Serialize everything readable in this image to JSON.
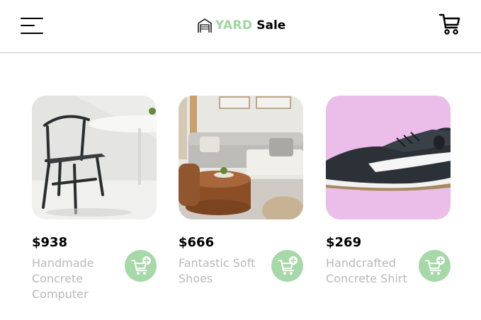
{
  "header": {
    "logo": {
      "brand_part1": "YARD",
      "brand_part2": "Sale",
      "icon": "garage-icon"
    },
    "menu_icon": "hamburger-menu-icon",
    "cart_icon": "shopping-cart-icon"
  },
  "colors": {
    "accent_green": "#a6d8a8",
    "logo_green": "#9fd6a2",
    "muted_text": "#b9b9b9",
    "divider": "#c8c8c8"
  },
  "products": [
    {
      "price": "$938",
      "name": "Handmade Concrete Computer",
      "image": "chair-photo",
      "add_icon": "add-to-cart-icon"
    },
    {
      "price": "$666",
      "name": "Fantastic Soft Shoes",
      "image": "living-room-photo",
      "add_icon": "add-to-cart-icon"
    },
    {
      "price": "$269",
      "name": "Handcrafted Concrete Shirt",
      "image": "sneaker-photo",
      "add_icon": "add-to-cart-icon"
    }
  ]
}
